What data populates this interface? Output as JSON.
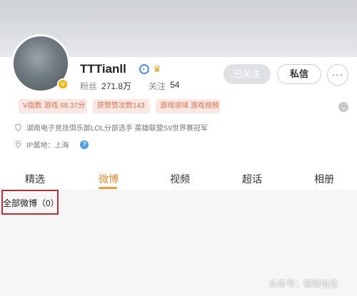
{
  "profile": {
    "username": "TTTianll",
    "fans_label": "粉丝",
    "fans_count": "271.8万",
    "following_label": "关注",
    "following_count": "54"
  },
  "actions": {
    "follow_label": "已关注",
    "message_label": "私信",
    "more_label": "···"
  },
  "tags": [
    "V指数 游戏 68.37分",
    "获赞赞次数143",
    "游戏领域 游戏视频"
  ],
  "info": {
    "bio": "湖南电子竞技俱乐部LOL分部选手 英雄联盟S9世界赛冠军",
    "ip_label": "IP属地：上海"
  },
  "tabs": [
    {
      "label": "精选",
      "active": false
    },
    {
      "label": "微博",
      "active": true
    },
    {
      "label": "视频",
      "active": false
    },
    {
      "label": "超话",
      "active": false
    },
    {
      "label": "相册",
      "active": false
    }
  ],
  "filter": {
    "label": "全部微博（0）"
  },
  "watermark": "头条号：锦城电竞",
  "colors": {
    "accent": "#f09a3c",
    "highlight_border": "#c0303a",
    "tag_bg": "#fbe8e2",
    "tag_text": "#e2704f"
  }
}
